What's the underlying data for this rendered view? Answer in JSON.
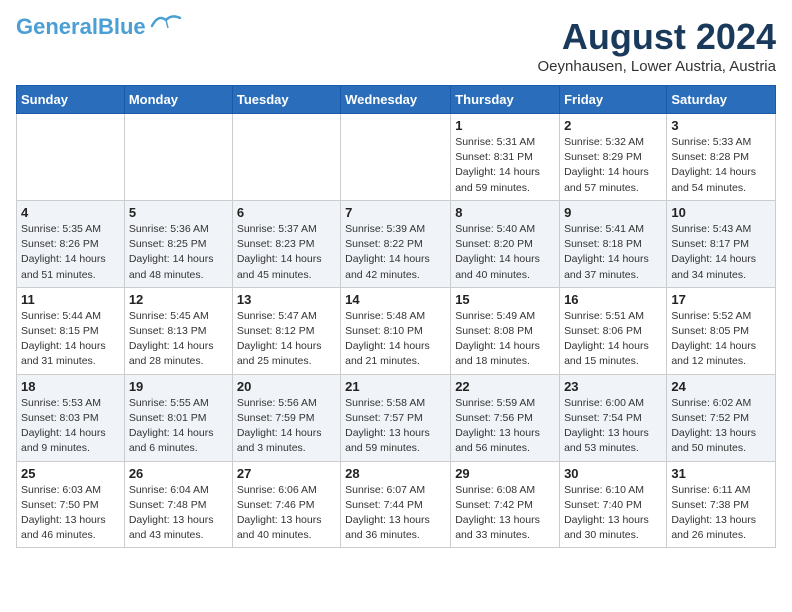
{
  "header": {
    "logo_line1": "General",
    "logo_line2": "Blue",
    "month": "August 2024",
    "location": "Oeynhausen, Lower Austria, Austria"
  },
  "weekdays": [
    "Sunday",
    "Monday",
    "Tuesday",
    "Wednesday",
    "Thursday",
    "Friday",
    "Saturday"
  ],
  "weeks": [
    [
      {
        "day": "",
        "info": ""
      },
      {
        "day": "",
        "info": ""
      },
      {
        "day": "",
        "info": ""
      },
      {
        "day": "",
        "info": ""
      },
      {
        "day": "1",
        "info": "Sunrise: 5:31 AM\nSunset: 8:31 PM\nDaylight: 14 hours\nand 59 minutes."
      },
      {
        "day": "2",
        "info": "Sunrise: 5:32 AM\nSunset: 8:29 PM\nDaylight: 14 hours\nand 57 minutes."
      },
      {
        "day": "3",
        "info": "Sunrise: 5:33 AM\nSunset: 8:28 PM\nDaylight: 14 hours\nand 54 minutes."
      }
    ],
    [
      {
        "day": "4",
        "info": "Sunrise: 5:35 AM\nSunset: 8:26 PM\nDaylight: 14 hours\nand 51 minutes."
      },
      {
        "day": "5",
        "info": "Sunrise: 5:36 AM\nSunset: 8:25 PM\nDaylight: 14 hours\nand 48 minutes."
      },
      {
        "day": "6",
        "info": "Sunrise: 5:37 AM\nSunset: 8:23 PM\nDaylight: 14 hours\nand 45 minutes."
      },
      {
        "day": "7",
        "info": "Sunrise: 5:39 AM\nSunset: 8:22 PM\nDaylight: 14 hours\nand 42 minutes."
      },
      {
        "day": "8",
        "info": "Sunrise: 5:40 AM\nSunset: 8:20 PM\nDaylight: 14 hours\nand 40 minutes."
      },
      {
        "day": "9",
        "info": "Sunrise: 5:41 AM\nSunset: 8:18 PM\nDaylight: 14 hours\nand 37 minutes."
      },
      {
        "day": "10",
        "info": "Sunrise: 5:43 AM\nSunset: 8:17 PM\nDaylight: 14 hours\nand 34 minutes."
      }
    ],
    [
      {
        "day": "11",
        "info": "Sunrise: 5:44 AM\nSunset: 8:15 PM\nDaylight: 14 hours\nand 31 minutes."
      },
      {
        "day": "12",
        "info": "Sunrise: 5:45 AM\nSunset: 8:13 PM\nDaylight: 14 hours\nand 28 minutes."
      },
      {
        "day": "13",
        "info": "Sunrise: 5:47 AM\nSunset: 8:12 PM\nDaylight: 14 hours\nand 25 minutes."
      },
      {
        "day": "14",
        "info": "Sunrise: 5:48 AM\nSunset: 8:10 PM\nDaylight: 14 hours\nand 21 minutes."
      },
      {
        "day": "15",
        "info": "Sunrise: 5:49 AM\nSunset: 8:08 PM\nDaylight: 14 hours\nand 18 minutes."
      },
      {
        "day": "16",
        "info": "Sunrise: 5:51 AM\nSunset: 8:06 PM\nDaylight: 14 hours\nand 15 minutes."
      },
      {
        "day": "17",
        "info": "Sunrise: 5:52 AM\nSunset: 8:05 PM\nDaylight: 14 hours\nand 12 minutes."
      }
    ],
    [
      {
        "day": "18",
        "info": "Sunrise: 5:53 AM\nSunset: 8:03 PM\nDaylight: 14 hours\nand 9 minutes."
      },
      {
        "day": "19",
        "info": "Sunrise: 5:55 AM\nSunset: 8:01 PM\nDaylight: 14 hours\nand 6 minutes."
      },
      {
        "day": "20",
        "info": "Sunrise: 5:56 AM\nSunset: 7:59 PM\nDaylight: 14 hours\nand 3 minutes."
      },
      {
        "day": "21",
        "info": "Sunrise: 5:58 AM\nSunset: 7:57 PM\nDaylight: 13 hours\nand 59 minutes."
      },
      {
        "day": "22",
        "info": "Sunrise: 5:59 AM\nSunset: 7:56 PM\nDaylight: 13 hours\nand 56 minutes."
      },
      {
        "day": "23",
        "info": "Sunrise: 6:00 AM\nSunset: 7:54 PM\nDaylight: 13 hours\nand 53 minutes."
      },
      {
        "day": "24",
        "info": "Sunrise: 6:02 AM\nSunset: 7:52 PM\nDaylight: 13 hours\nand 50 minutes."
      }
    ],
    [
      {
        "day": "25",
        "info": "Sunrise: 6:03 AM\nSunset: 7:50 PM\nDaylight: 13 hours\nand 46 minutes."
      },
      {
        "day": "26",
        "info": "Sunrise: 6:04 AM\nSunset: 7:48 PM\nDaylight: 13 hours\nand 43 minutes."
      },
      {
        "day": "27",
        "info": "Sunrise: 6:06 AM\nSunset: 7:46 PM\nDaylight: 13 hours\nand 40 minutes."
      },
      {
        "day": "28",
        "info": "Sunrise: 6:07 AM\nSunset: 7:44 PM\nDaylight: 13 hours\nand 36 minutes."
      },
      {
        "day": "29",
        "info": "Sunrise: 6:08 AM\nSunset: 7:42 PM\nDaylight: 13 hours\nand 33 minutes."
      },
      {
        "day": "30",
        "info": "Sunrise: 6:10 AM\nSunset: 7:40 PM\nDaylight: 13 hours\nand 30 minutes."
      },
      {
        "day": "31",
        "info": "Sunrise: 6:11 AM\nSunset: 7:38 PM\nDaylight: 13 hours\nand 26 minutes."
      }
    ]
  ]
}
